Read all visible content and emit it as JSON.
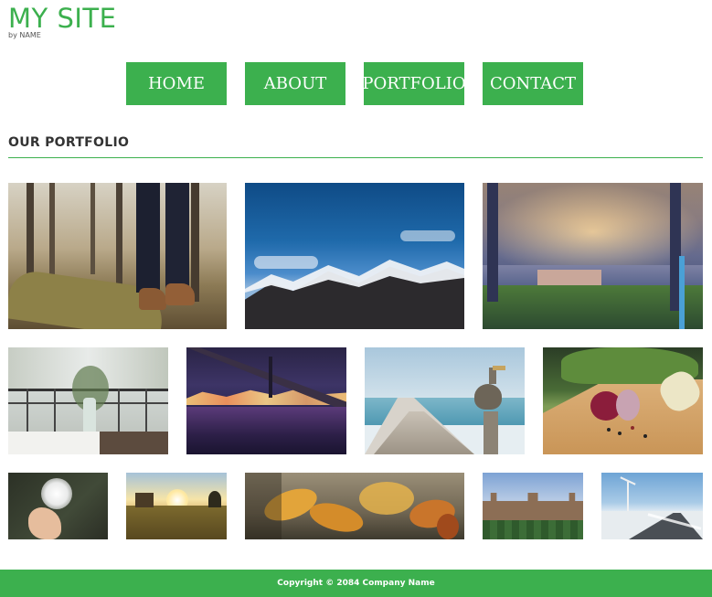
{
  "header": {
    "title": "MY SITE",
    "byline": "by NAME"
  },
  "nav": {
    "items": [
      {
        "label": "HOME"
      },
      {
        "label": "ABOUT"
      },
      {
        "label": "PORTFOLIO"
      },
      {
        "label": "CONTACT"
      }
    ]
  },
  "main": {
    "heading": "OUR PORTFOLIO"
  },
  "colors": {
    "accent": "#3cb04e",
    "text": "#333333",
    "background": "#ffffff"
  },
  "footer": {
    "copyright": "Copyright © 2084 Company Name"
  }
}
